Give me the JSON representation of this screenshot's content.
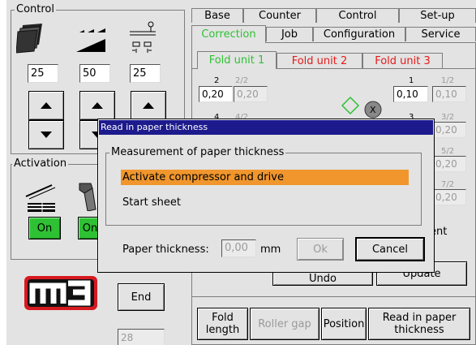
{
  "control": {
    "title": "Control",
    "values": [
      "25",
      "50",
      "25"
    ],
    "icons": [
      "paper-stack-icon",
      "ramp-icon",
      "stop-gauge-icon"
    ]
  },
  "activation": {
    "title": "Activation",
    "buttons": [
      "On",
      "On"
    ],
    "icons": [
      "sheet-feed-icon",
      "knife-icon"
    ]
  },
  "logo_text": "m3",
  "end_label": "End",
  "bottom_field": "28",
  "tabs_row1": [
    "Base",
    "Counter",
    "Control",
    "Set-up"
  ],
  "tabs_row2": [
    "Correction",
    "Job",
    "Configuration",
    "Service"
  ],
  "fold_tabs": [
    "Fold unit 1",
    "Fold unit 2",
    "Fold unit 3"
  ],
  "fold_left": {
    "l1": "2",
    "l2": "2/2",
    "v1": "0,20",
    "v2": "0,20",
    "l3": "4",
    "l4": "4/2"
  },
  "fold_right": {
    "l1": "1",
    "l2": "1/2",
    "v1": "0,10",
    "v2": "0,10",
    "l3": "3",
    "l4": "3/2",
    "v4": "0,20",
    "l5": "5/2",
    "v5": "0,20",
    "l6": "7/2",
    "v6": "0,20"
  },
  "behind_text": {
    "ent": "ent",
    "undo": "Undo",
    "update": "Update"
  },
  "bottom_buttons": [
    "Fold length",
    "Roller gap",
    "Position",
    "Read in paper thickness"
  ],
  "dialog": {
    "title": "Read in paper thickness",
    "group_title": "Measurement of paper thickness",
    "step_active": "Activate compressor and drive",
    "step_next": "Start sheet",
    "thickness_label": "Paper thickness:",
    "thickness_value": "0,00",
    "unit": "mm",
    "ok": "Ok",
    "cancel": "Cancel"
  },
  "colors": {
    "accent_green": "#2ec133",
    "tab_green": "#2ec133",
    "tab_red": "#e61a1a",
    "title_bar": "#1c1a8c",
    "highlight": "#f0962d",
    "logo_red": "#d71920"
  }
}
